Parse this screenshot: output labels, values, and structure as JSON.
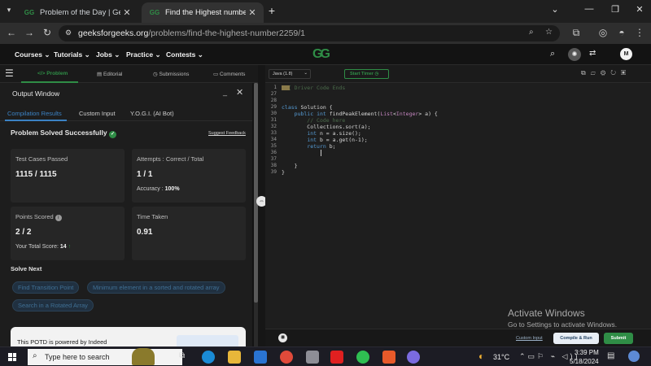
{
  "browser": {
    "tabs": [
      {
        "title": "Problem of the Day | GeeksforG",
        "active": false
      },
      {
        "title": "Find the Highest number | Prac",
        "active": true
      }
    ],
    "new_tab": "+",
    "url_domain": "geeksforgeeks.org",
    "url_path": "/problems/find-the-highest-number2259/1"
  },
  "site_nav": {
    "items": [
      "Courses",
      "Tutorials",
      "Jobs",
      "Practice",
      "Contests"
    ],
    "logo": "GG",
    "avatar_initial": "M"
  },
  "problem_tabs": [
    "Problem",
    "Editorial",
    "Submissions",
    "Comments"
  ],
  "output": {
    "window_title": "Output Window",
    "subtabs": [
      "Compilation Results",
      "Custom Input",
      "Y.O.G.I. (AI Bot)"
    ],
    "status": "Problem Solved Successfully",
    "suggest_feedback": "Suggest Feedback",
    "test_cases_label": "Test Cases Passed",
    "test_cases_value": "1115 / 1115",
    "attempts_label": "Attempts : Correct / Total",
    "attempts_value": "1 / 1",
    "accuracy_label": "Accuracy :",
    "accuracy_value": "100%",
    "points_label": "Points Scored",
    "points_value": "2 / 2",
    "total_score_label": "Your Total Score:",
    "total_score_value": "14",
    "time_label": "Time Taken",
    "time_value": "0.91",
    "solve_next_label": "Solve Next",
    "solve_next": [
      "Find Transition Point",
      "Minimum element in a sorted and rotated array",
      "Search in a Rotated Array"
    ],
    "potd_text": "This POTD is powered by Indeed"
  },
  "editor": {
    "language": "Java (1.8)",
    "start_timer": "Start Timer",
    "lines": [
      {
        "n": "1",
        "text": "//{ Driver Code Ends"
      },
      {
        "n": "27",
        "text": ""
      },
      {
        "n": "28",
        "text": ""
      },
      {
        "n": "29",
        "text": "class Solution {"
      },
      {
        "n": "30",
        "text": "    public int findPeakElement(List<Integer> a) {"
      },
      {
        "n": "31",
        "text": "        // Code here"
      },
      {
        "n": "32",
        "text": "        Collections.sort(a);"
      },
      {
        "n": "33",
        "text": "        int n = a.size();"
      },
      {
        "n": "34",
        "text": "        int b = a.get(n-1);"
      },
      {
        "n": "35",
        "text": "        return b;"
      },
      {
        "n": "36",
        "text": ""
      },
      {
        "n": "37",
        "text": ""
      },
      {
        "n": "38",
        "text": "    }"
      },
      {
        "n": "39",
        "text": "}"
      }
    ],
    "custom_input": "Custom Input",
    "compile_run": "Compile & Run",
    "submit": "Submit"
  },
  "watermark": {
    "title": "Activate Windows",
    "subtitle": "Go to Settings to activate Windows."
  },
  "taskbar": {
    "search_placeholder": "Type here to search",
    "temperature": "31°C",
    "time": "3:39 PM",
    "date": "5/18/2024"
  },
  "colors": {
    "gfg_green": "#2f8d46",
    "accent_blue": "#3b82c4",
    "success": "#2f8d46"
  }
}
